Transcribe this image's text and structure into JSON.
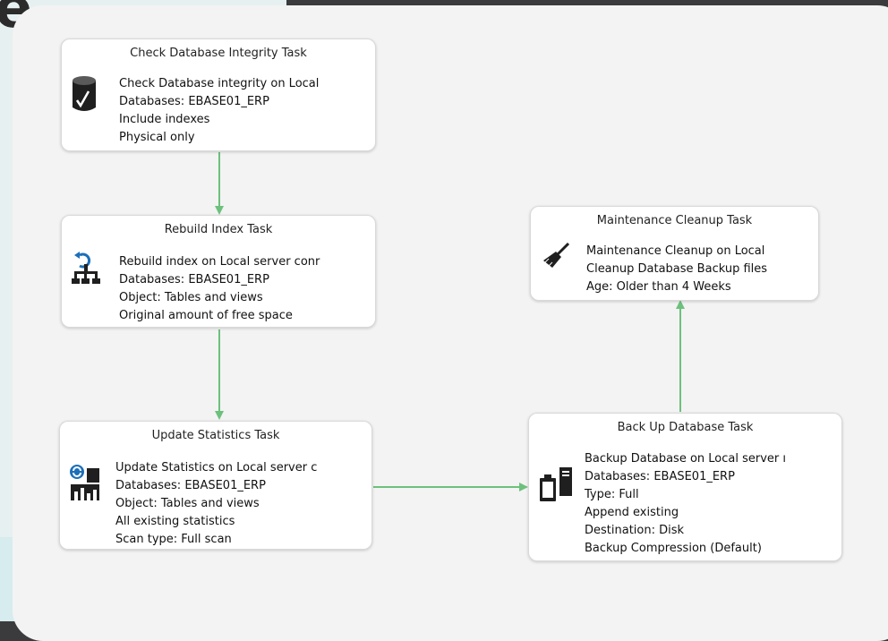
{
  "heading_fragment": "e",
  "colors": {
    "connector": "#6cc17c",
    "canvas": "#f3f3f3",
    "backdrop": "#3b3b3d"
  },
  "tasks": [
    {
      "id": "check-integrity",
      "title": "Check Database Integrity Task",
      "icon": "database-check-icon",
      "lines": [
        "Check Database integrity on Local",
        "Databases: EBASE01_ERP",
        "Include indexes",
        "Physical only"
      ]
    },
    {
      "id": "rebuild-index",
      "title": "Rebuild Index Task",
      "icon": "rebuild-index-icon",
      "lines": [
        "Rebuild index on Local server conr",
        "Databases: EBASE01_ERP",
        "Object: Tables and views",
        "Original amount of free space"
      ]
    },
    {
      "id": "update-statistics",
      "title": "Update Statistics Task",
      "icon": "update-statistics-icon",
      "lines": [
        "Update Statistics on Local server c",
        "Databases: EBASE01_ERP",
        "Object: Tables and views",
        "All existing statistics",
        "Scan type: Full scan"
      ]
    },
    {
      "id": "maintenance-cleanup",
      "title": "Maintenance Cleanup Task",
      "icon": "broom-icon",
      "lines": [
        "Maintenance Cleanup on Local",
        "Cleanup Database Backup files",
        "Age: Older than 4 Weeks"
      ]
    },
    {
      "id": "backup-database",
      "title": "Back Up Database Task",
      "icon": "backup-database-icon",
      "lines": [
        "Backup Database on Local server ı",
        "Databases: EBASE01_ERP",
        "Type: Full",
        "Append existing",
        "Destination: Disk",
        "Backup Compression (Default)"
      ]
    }
  ]
}
